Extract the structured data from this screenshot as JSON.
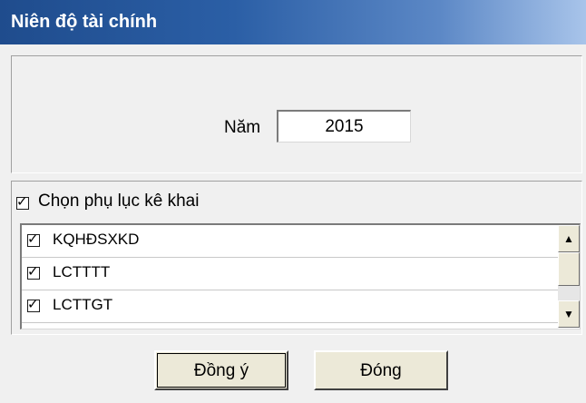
{
  "window": {
    "title": "Niên độ tài chính"
  },
  "year": {
    "label": "Năm",
    "value": "2015"
  },
  "appendix": {
    "select_all_label": "Chọn phụ lục kê khai",
    "select_all_checked": true,
    "items": [
      {
        "label": "KQHĐSXKD",
        "checked": true
      },
      {
        "label": "LCTTTT",
        "checked": true
      },
      {
        "label": "LCTTGT",
        "checked": true
      }
    ]
  },
  "icons": {
    "scroll_up": "up-arrow-icon",
    "scroll_down": "down-arrow-icon"
  },
  "buttons": {
    "ok_label": "Đồng ý",
    "close_label": "Đóng"
  },
  "colors": {
    "title_start": "#1f4c8d",
    "title_end": "#a8c4ea",
    "dialog_bg": "#f0f0f0"
  }
}
